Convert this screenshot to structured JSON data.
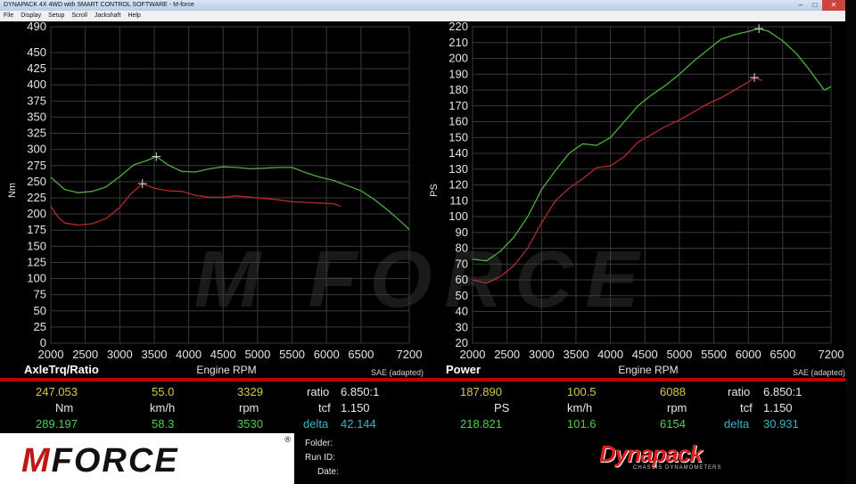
{
  "window": {
    "title": "DYNAPACK 4X 4WD with SMART CONTROL SOFTWARE - M-force",
    "menu": [
      "File",
      "Display",
      "Setup",
      "Scroll",
      "Jackshaft",
      "Help"
    ]
  },
  "watermark": "M FORCE",
  "chart_data": [
    {
      "type": "line",
      "title": "AxleTrq/Ratio",
      "xlabel": "Engine RPM",
      "ylabel": "Nm",
      "note": "SAE (adapted)",
      "xlim": [
        2000,
        7200
      ],
      "ylim": [
        0,
        490
      ],
      "xticks": [
        2000,
        2500,
        3000,
        3500,
        4000,
        4500,
        5000,
        5500,
        6000,
        6500,
        7200
      ],
      "yticks": [
        0,
        25,
        50,
        75,
        100,
        125,
        150,
        175,
        200,
        225,
        250,
        275,
        300,
        325,
        350,
        375,
        400,
        425,
        450,
        490
      ],
      "grid": true,
      "series": [
        {
          "color": "#4fae3f",
          "x": [
            2000,
            2200,
            2400,
            2600,
            2800,
            3000,
            3200,
            3400,
            3530,
            3700,
            3900,
            4100,
            4300,
            4500,
            4700,
            4900,
            5100,
            5300,
            5500,
            5700,
            5900,
            6100,
            6300,
            6500,
            6700,
            6900,
            7100,
            7200
          ],
          "y": [
            257,
            238,
            233,
            235,
            242,
            258,
            276,
            283,
            289,
            276,
            266,
            265,
            270,
            273,
            272,
            270,
            271,
            272,
            272,
            264,
            257,
            252,
            244,
            236,
            222,
            205,
            186,
            176
          ]
        },
        {
          "color": "#b42a2a",
          "x": [
            2000,
            2100,
            2200,
            2400,
            2600,
            2800,
            3000,
            3150,
            3329,
            3500,
            3700,
            3900,
            4100,
            4300,
            4500,
            4700,
            4900,
            5100,
            5300,
            5500,
            5700,
            5900,
            6100,
            6200
          ],
          "y": [
            212,
            196,
            186,
            183,
            185,
            193,
            210,
            230,
            247,
            240,
            236,
            235,
            229,
            226,
            226,
            228,
            226,
            224,
            222,
            219,
            218,
            217,
            216,
            212
          ]
        }
      ],
      "markers": [
        {
          "x": 3530,
          "y": 289,
          "color": "#4fae3f"
        },
        {
          "x": 3329,
          "y": 247,
          "color": "#b42a2a"
        }
      ]
    },
    {
      "type": "line",
      "title": "Power",
      "xlabel": "Engine RPM",
      "ylabel": "PS",
      "note": "SAE (adapted)",
      "xlim": [
        2000,
        7200
      ],
      "ylim": [
        20,
        220
      ],
      "xticks": [
        2000,
        2500,
        3000,
        3500,
        4000,
        4500,
        5000,
        5500,
        6000,
        6500,
        7200
      ],
      "yticks": [
        20,
        30,
        40,
        50,
        60,
        70,
        80,
        90,
        100,
        110,
        120,
        130,
        140,
        150,
        160,
        170,
        180,
        190,
        200,
        210,
        220
      ],
      "grid": true,
      "series": [
        {
          "color": "#4fae3f",
          "x": [
            2000,
            2200,
            2400,
            2600,
            2800,
            3000,
            3200,
            3400,
            3600,
            3800,
            4000,
            4200,
            4400,
            4600,
            4800,
            5000,
            5200,
            5400,
            5600,
            5800,
            6000,
            6154,
            6300,
            6500,
            6700,
            6900,
            7100,
            7200
          ],
          "y": [
            73,
            72,
            78,
            87,
            100,
            117,
            129,
            140,
            146,
            145,
            150,
            160,
            170,
            177,
            183,
            190,
            198,
            205,
            212,
            215,
            217,
            218.8,
            217,
            211,
            203,
            192,
            180,
            182
          ]
        },
        {
          "color": "#b42a2a",
          "x": [
            2000,
            2200,
            2400,
            2600,
            2800,
            3000,
            3200,
            3400,
            3600,
            3800,
            4000,
            4200,
            4400,
            4600,
            4800,
            5000,
            5200,
            5400,
            5600,
            5800,
            6000,
            6088,
            6200
          ],
          "y": [
            60,
            58,
            62,
            69,
            80,
            96,
            110,
            118,
            124,
            131,
            132,
            138,
            147,
            152,
            157,
            161,
            166,
            171,
            175,
            180,
            185,
            187.9,
            186
          ]
        }
      ],
      "markers": [
        {
          "x": 6154,
          "y": 218.8,
          "color": "#4fae3f"
        },
        {
          "x": 6088,
          "y": 187.9,
          "color": "#b42a2a"
        }
      ]
    }
  ],
  "panels": {
    "left": {
      "row1": {
        "val": "247.053",
        "speed": "55.0",
        "rpm": "3329",
        "ratio_label": "ratio",
        "ratio": "6.850:1"
      },
      "row2": {
        "unit": "Nm",
        "speed_unit": "km/h",
        "rpm_unit": "rpm",
        "tcf_label": "tcf",
        "tcf": "1.150"
      },
      "row3": {
        "val": "289.197",
        "speed": "58.3",
        "rpm": "3530",
        "delta_label": "delta",
        "delta": "42.144"
      }
    },
    "right": {
      "row1": {
        "val": "187.890",
        "speed": "100.5",
        "rpm": "6088",
        "ratio_label": "ratio",
        "ratio": "6.850:1"
      },
      "row2": {
        "unit": "PS",
        "speed_unit": "km/h",
        "rpm_unit": "rpm",
        "tcf_label": "tcf",
        "tcf": "1.150"
      },
      "row3": {
        "val": "218.821",
        "speed": "101.6",
        "rpm": "6154",
        "delta_label": "delta",
        "delta": "30.931"
      }
    }
  },
  "info": {
    "folder": "Folder:",
    "run_id": "Run ID:",
    "date": "Date:"
  },
  "logos": {
    "mforce_m": "M",
    "mforce_text": "FORCE",
    "registered": "®",
    "dynapack": "Dynapack",
    "dynapack_tagline": "CHASSIS DYNAMOMETERS"
  }
}
